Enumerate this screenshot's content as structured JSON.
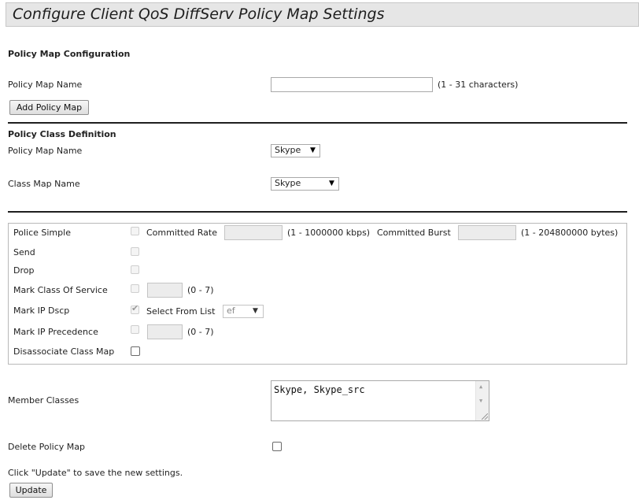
{
  "page": {
    "title": "Configure Client QoS DiffServ Policy Map Settings"
  },
  "policy_map_config": {
    "heading": "Policy Map Configuration",
    "name_label": "Policy Map Name",
    "name_value": "",
    "name_hint": "(1 - 31 characters)",
    "add_button": "Add Policy Map"
  },
  "policy_class": {
    "heading": "Policy Class Definition",
    "policy_map_label": "Policy Map Name",
    "policy_map_selected": "Skype",
    "class_map_label": "Class Map Name",
    "class_map_selected": "Skype"
  },
  "actions": {
    "police_simple": {
      "label": "Police Simple",
      "checked": false,
      "committed_rate_label": "Committed Rate",
      "committed_rate_value": "",
      "committed_rate_hint": "(1 - 1000000 kbps)",
      "committed_burst_label": "Committed Burst",
      "committed_burst_value": "",
      "committed_burst_hint": "(1 - 204800000 bytes)"
    },
    "send": {
      "label": "Send",
      "checked": false
    },
    "drop": {
      "label": "Drop",
      "checked": false
    },
    "mark_cos": {
      "label": "Mark Class Of Service",
      "checked": false,
      "value": "",
      "hint": "(0 - 7)"
    },
    "mark_dscp": {
      "label": "Mark IP Dscp",
      "checked": true,
      "select_from_list_label": "Select From List",
      "selected": "ef"
    },
    "mark_precedence": {
      "label": "Mark IP Precedence",
      "checked": false,
      "value": "",
      "hint": "(0 - 7)"
    },
    "disassociate": {
      "label": "Disassociate Class Map",
      "checked": false
    }
  },
  "member_classes": {
    "label": "Member Classes",
    "value": "Skype, Skype_src"
  },
  "delete_policy": {
    "label": "Delete Policy Map",
    "checked": false
  },
  "footer": {
    "instruction": "Click \"Update\" to save the new settings.",
    "update_button": "Update"
  },
  "icons": {
    "dropdown": "triangle-down-icon",
    "scroll_up": "scroll-up-icon",
    "scroll_down": "scroll-down-icon",
    "checkmark": "checkmark-icon"
  },
  "colors": {
    "title_bg": "#e6e6e6",
    "separator": "#1e1e1e",
    "disabled_field": "#ececec"
  }
}
